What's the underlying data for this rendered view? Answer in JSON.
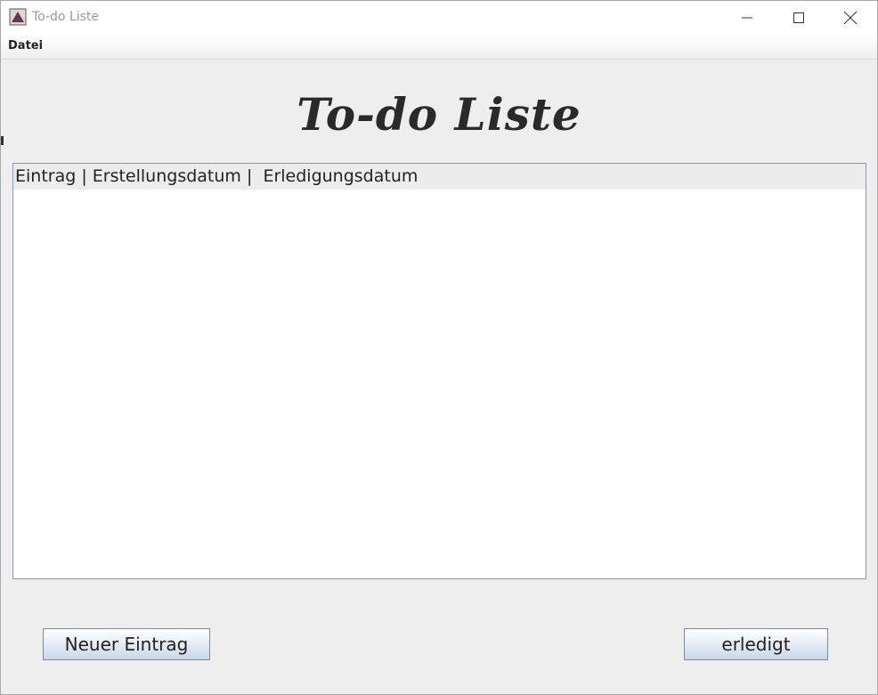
{
  "window": {
    "title": "To-do Liste",
    "controls": {
      "minimize": "minimize-icon",
      "maximize": "maximize-icon",
      "close": "close-icon"
    }
  },
  "menubar": {
    "items": [
      {
        "label": "Datei"
      }
    ]
  },
  "main": {
    "heading": "To-do Liste",
    "list": {
      "header": "Eintrag | Erstellungsdatum |  Erledigungsdatum",
      "items": []
    }
  },
  "buttons": {
    "new_entry": "Neuer Eintrag",
    "done": "erledigt"
  },
  "colors": {
    "background": "#eeeeee",
    "list_border": "#8e98a4",
    "button_border": "#7a8a9c",
    "heading_text": "#2a2a2a"
  }
}
